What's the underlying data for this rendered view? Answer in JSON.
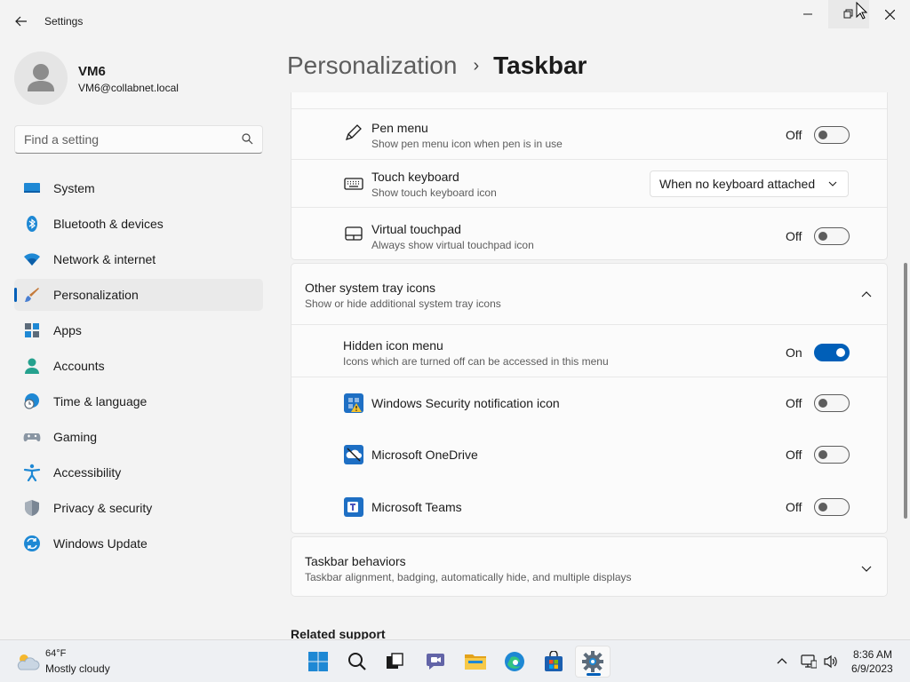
{
  "window": {
    "title": "Settings",
    "back_icon": "arrow-left-icon",
    "controls": [
      "minimize-icon",
      "restore-icon",
      "close-icon"
    ]
  },
  "profile": {
    "name": "VM6",
    "email": "VM6@collabnet.local"
  },
  "search": {
    "placeholder": "Find a setting",
    "value": ""
  },
  "sidebar": {
    "selected": "Personalization",
    "items": [
      {
        "label": "System",
        "icon": "monitor-icon"
      },
      {
        "label": "Bluetooth & devices",
        "icon": "bluetooth-icon"
      },
      {
        "label": "Network & internet",
        "icon": "wifi-icon"
      },
      {
        "label": "Personalization",
        "icon": "paintbrush-icon"
      },
      {
        "label": "Apps",
        "icon": "apps-icon"
      },
      {
        "label": "Accounts",
        "icon": "person-icon"
      },
      {
        "label": "Time & language",
        "icon": "clock-globe-icon"
      },
      {
        "label": "Gaming",
        "icon": "gamepad-icon"
      },
      {
        "label": "Accessibility",
        "icon": "accessibility-icon"
      },
      {
        "label": "Privacy & security",
        "icon": "shield-icon"
      },
      {
        "label": "Windows Update",
        "icon": "update-icon"
      }
    ]
  },
  "header": {
    "parent": "Personalization",
    "separator": "›",
    "current": "Taskbar"
  },
  "corner_icons": {
    "rows": [
      {
        "title": "Pen menu",
        "subtitle": "Show pen menu icon when pen is in use",
        "state": "Off",
        "icon": "pen-icon"
      },
      {
        "title": "Touch keyboard",
        "subtitle": "Show touch keyboard icon",
        "dropdown_value": "When no keyboard attached",
        "icon": "keyboard-icon"
      },
      {
        "title": "Virtual touchpad",
        "subtitle": "Always show virtual touchpad icon",
        "state": "Off",
        "icon": "touchpad-icon"
      }
    ]
  },
  "other_tray": {
    "title": "Other system tray icons",
    "subtitle": "Show or hide additional system tray icons",
    "expanded": true,
    "hidden_menu": {
      "title": "Hidden icon menu",
      "subtitle": "Icons which are turned off can be accessed in this menu",
      "state": "On"
    },
    "apps": [
      {
        "title": "Windows Security notification icon",
        "state": "Off",
        "icon": "windows-security-icon"
      },
      {
        "title": "Microsoft OneDrive",
        "state": "Off",
        "icon": "onedrive-icon"
      },
      {
        "title": "Microsoft Teams",
        "state": "Off",
        "icon": "teams-icon"
      }
    ]
  },
  "behaviors": {
    "title": "Taskbar behaviors",
    "subtitle": "Taskbar alignment, badging, automatically hide, and multiple displays",
    "expanded": false
  },
  "related": {
    "title": "Related support"
  },
  "taskbar": {
    "weather": {
      "temp": "64°F",
      "desc": "Mostly cloudy",
      "icon": "weather-cloud-sun-icon"
    },
    "apps": [
      "windows-start-icon",
      "search-icon",
      "task-view-icon",
      "teams-chat-icon",
      "file-explorer-icon",
      "edge-icon",
      "store-icon",
      "settings-gear-icon"
    ],
    "tray": [
      "chevron-up-icon",
      "network-icon",
      "volume-icon"
    ],
    "time": "8:36 AM",
    "date": "6/9/2023"
  },
  "colors": {
    "accent": "#005fb8",
    "background": "#f3f3f3",
    "card": "#fbfbfb"
  }
}
